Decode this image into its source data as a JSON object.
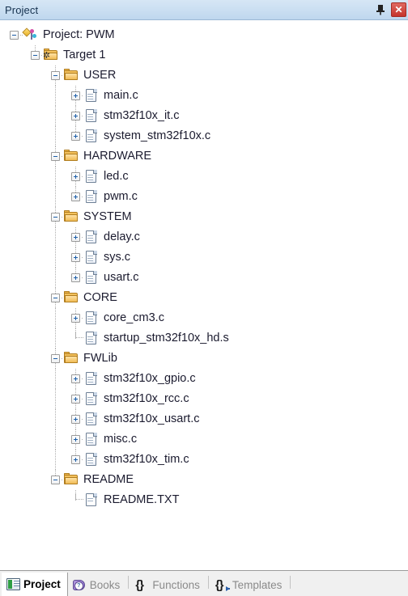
{
  "panel": {
    "title": "Project",
    "pin_icon": "pin-icon",
    "close_icon": "close-icon",
    "close_label": "✕",
    "pin_label": "⚲"
  },
  "colors": {
    "titlebar": "#cbdff2",
    "close_button": "#c5342c",
    "folder": "#e0a336",
    "text": "#1b1b2f",
    "tab_inactive_text": "#8a8a8a"
  },
  "tree": [
    {
      "label": "Project: PWM",
      "level": 0,
      "icon": "project-icon",
      "expander": "minus"
    },
    {
      "label": "Target 1",
      "level": 1,
      "icon": "target-icon",
      "expander": "minus"
    },
    {
      "label": "USER",
      "level": 2,
      "icon": "folder-icon",
      "expander": "minus"
    },
    {
      "label": "main.c",
      "level": 3,
      "icon": "c-file-icon",
      "expander": "plus"
    },
    {
      "label": "stm32f10x_it.c",
      "level": 3,
      "icon": "c-file-icon",
      "expander": "plus"
    },
    {
      "label": "system_stm32f10x.c",
      "level": 3,
      "icon": "c-file-icon",
      "expander": "plus"
    },
    {
      "label": "HARDWARE",
      "level": 2,
      "icon": "folder-icon",
      "expander": "minus"
    },
    {
      "label": "led.c",
      "level": 3,
      "icon": "c-file-icon",
      "expander": "plus"
    },
    {
      "label": "pwm.c",
      "level": 3,
      "icon": "c-file-icon",
      "expander": "plus"
    },
    {
      "label": "SYSTEM",
      "level": 2,
      "icon": "folder-icon",
      "expander": "minus"
    },
    {
      "label": "delay.c",
      "level": 3,
      "icon": "c-file-icon",
      "expander": "plus"
    },
    {
      "label": "sys.c",
      "level": 3,
      "icon": "c-file-icon",
      "expander": "plus"
    },
    {
      "label": "usart.c",
      "level": 3,
      "icon": "c-file-icon",
      "expander": "plus"
    },
    {
      "label": "CORE",
      "level": 2,
      "icon": "folder-icon",
      "expander": "minus"
    },
    {
      "label": "core_cm3.c",
      "level": 3,
      "icon": "c-file-icon",
      "expander": "plus"
    },
    {
      "label": "startup_stm32f10x_hd.s",
      "level": 3,
      "icon": "asm-file-icon",
      "expander": "none"
    },
    {
      "label": "FWLib",
      "level": 2,
      "icon": "folder-icon",
      "expander": "minus"
    },
    {
      "label": "stm32f10x_gpio.c",
      "level": 3,
      "icon": "c-file-icon",
      "expander": "plus"
    },
    {
      "label": "stm32f10x_rcc.c",
      "level": 3,
      "icon": "c-file-icon",
      "expander": "plus"
    },
    {
      "label": "stm32f10x_usart.c",
      "level": 3,
      "icon": "c-file-icon",
      "expander": "plus"
    },
    {
      "label": "misc.c",
      "level": 3,
      "icon": "c-file-icon",
      "expander": "plus"
    },
    {
      "label": "stm32f10x_tim.c",
      "level": 3,
      "icon": "c-file-icon",
      "expander": "plus"
    },
    {
      "label": "README",
      "level": 2,
      "icon": "folder-icon",
      "expander": "minus"
    },
    {
      "label": "README.TXT",
      "level": 3,
      "icon": "txt-file-icon",
      "expander": "none"
    }
  ],
  "tabs": [
    {
      "label": "Project",
      "icon": "project-tab-icon",
      "active": true
    },
    {
      "label": "Books",
      "icon": "books-tab-icon",
      "active": false
    },
    {
      "label": "Functions",
      "icon": "functions-tab-icon",
      "active": false
    },
    {
      "label": "Templates",
      "icon": "templates-tab-icon",
      "active": false
    }
  ]
}
